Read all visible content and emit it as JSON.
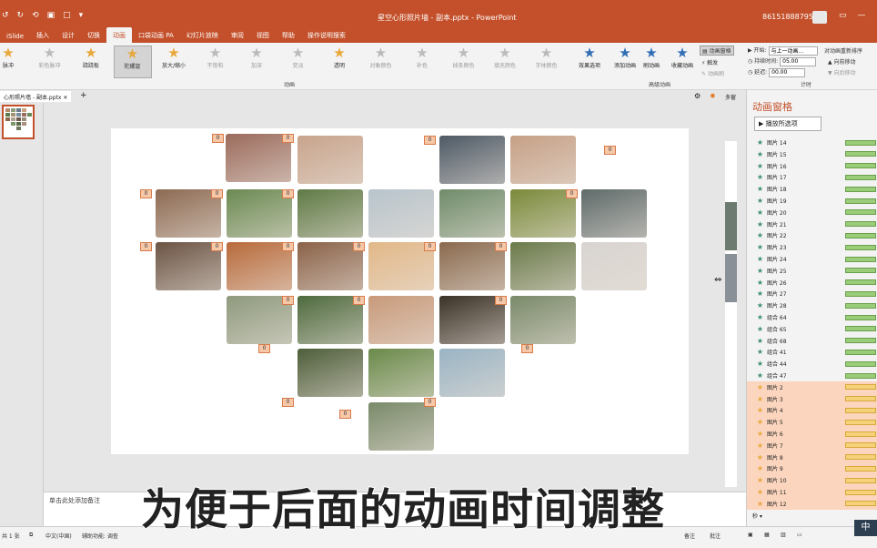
{
  "titlebar": {
    "qat_icons": [
      "undo-icon",
      "redo-icon",
      "refresh-icon",
      "slideshow-icon",
      "save-icon",
      "customize-icon"
    ],
    "qat_glyphs": [
      "↺",
      "↻",
      "⟲",
      "▣",
      "□",
      "▾"
    ],
    "document_title": "星空心形照片墙 - 副本.pptx - PowerPoint",
    "user": "8615188879582",
    "window_buttons": [
      "▭",
      "—",
      "❐"
    ]
  },
  "tabs": [
    {
      "label": "iSlide",
      "active": false
    },
    {
      "label": "插入",
      "active": false
    },
    {
      "label": "设计",
      "active": false
    },
    {
      "label": "切换",
      "active": false
    },
    {
      "label": "动画",
      "active": true
    },
    {
      "label": "口袋动画 PA",
      "active": false
    },
    {
      "label": "幻灯片放映",
      "active": false
    },
    {
      "label": "审阅",
      "active": false
    },
    {
      "label": "视图",
      "active": false
    },
    {
      "label": "帮助",
      "active": false
    },
    {
      "label": "操作说明搜索",
      "active": false
    }
  ],
  "effects": [
    {
      "label": "脉冲",
      "gold": true
    },
    {
      "label": "彩色脉冲",
      "gold": false
    },
    {
      "label": "跷跷板",
      "gold": true
    },
    {
      "label": "陀螺旋",
      "gold": true,
      "selected": true
    },
    {
      "label": "放大/缩小",
      "gold": true
    },
    {
      "label": "不饱和",
      "gold": false
    },
    {
      "label": "加深",
      "gold": false
    },
    {
      "label": "变淡",
      "gold": false
    },
    {
      "label": "透明",
      "gold": true
    },
    {
      "label": "对象颜色",
      "gold": false
    },
    {
      "label": "补色",
      "gold": false
    },
    {
      "label": "线条颜色",
      "gold": false
    },
    {
      "label": "填充颜色",
      "gold": false
    },
    {
      "label": "字体颜色",
      "gold": false
    }
  ],
  "ribbon": {
    "effect_options": "效果选项",
    "group_animation": "动画",
    "add_animation": "添加动画",
    "animation_painter": "刷动画",
    "timing_tool": "收藏动画",
    "animation_pane_btn": "动画窗格",
    "trigger": "触发",
    "anim_copy": "动画刷",
    "group_advanced": "高级动画",
    "start_label": "开始:",
    "start_value": "与上一动画...",
    "duration_label": "持续时间:",
    "duration_value": "05.00",
    "delay_label": "延迟:",
    "delay_value": "00.00",
    "reorder": "对动画重新排序",
    "move_earlier": "向前移动",
    "move_later": "向后移动",
    "group_timing": "计时"
  },
  "doc_tab": "心形照片墙 - 副本.pptx",
  "doc_tab_right": "多窗",
  "slide_badge": "0",
  "notes_placeholder": "单击此处添加备注",
  "animation_pane": {
    "title": "动画窗格",
    "play_button": "播放所选项",
    "items": [
      {
        "name": "图片 14",
        "type": "green"
      },
      {
        "name": "图片 15",
        "type": "green"
      },
      {
        "name": "图片 16",
        "type": "green"
      },
      {
        "name": "图片 17",
        "type": "green"
      },
      {
        "name": "图片 18",
        "type": "green"
      },
      {
        "name": "图片 19",
        "type": "green"
      },
      {
        "name": "图片 20",
        "type": "green"
      },
      {
        "name": "图片 21",
        "type": "green"
      },
      {
        "name": "图片 22",
        "type": "green"
      },
      {
        "name": "图片 23",
        "type": "green"
      },
      {
        "name": "图片 24",
        "type": "green"
      },
      {
        "name": "图片 25",
        "type": "green"
      },
      {
        "name": "图片 26",
        "type": "green"
      },
      {
        "name": "图片 27",
        "type": "green"
      },
      {
        "name": "图片 28",
        "type": "green"
      },
      {
        "name": "组合 64",
        "type": "green"
      },
      {
        "name": "组合 65",
        "type": "green"
      },
      {
        "name": "组合 68",
        "type": "green"
      },
      {
        "name": "组合 41",
        "type": "green"
      },
      {
        "name": "组合 44",
        "type": "green"
      },
      {
        "name": "组合 47",
        "type": "green"
      },
      {
        "name": "图片 2",
        "type": "gold"
      },
      {
        "name": "图片 3",
        "type": "gold"
      },
      {
        "name": "图片 4",
        "type": "gold"
      },
      {
        "name": "图片 5",
        "type": "gold"
      },
      {
        "name": "图片 6",
        "type": "gold"
      },
      {
        "name": "图片 7",
        "type": "gold"
      },
      {
        "name": "图片 8",
        "type": "gold"
      },
      {
        "name": "图片 9",
        "type": "gold"
      },
      {
        "name": "图片 10",
        "type": "gold"
      },
      {
        "name": "图片 11",
        "type": "gold"
      },
      {
        "name": "图片 12",
        "type": "gold"
      }
    ],
    "footer": "秒 ▾"
  },
  "status": {
    "slide_count": "共 1 张",
    "language": "中文(中国)",
    "accessibility": "辅助功能: 调查",
    "notes": "备注",
    "comments": "批注"
  },
  "caption": "为便于后面的动画时间调整",
  "ime": "中",
  "colors": {
    "accent": "#c3502a",
    "green_bar": "#9bcc7a",
    "gold_bar": "#f5d27a",
    "gold_row": "#fbd5bd",
    "badge": "#f6c8a8"
  }
}
